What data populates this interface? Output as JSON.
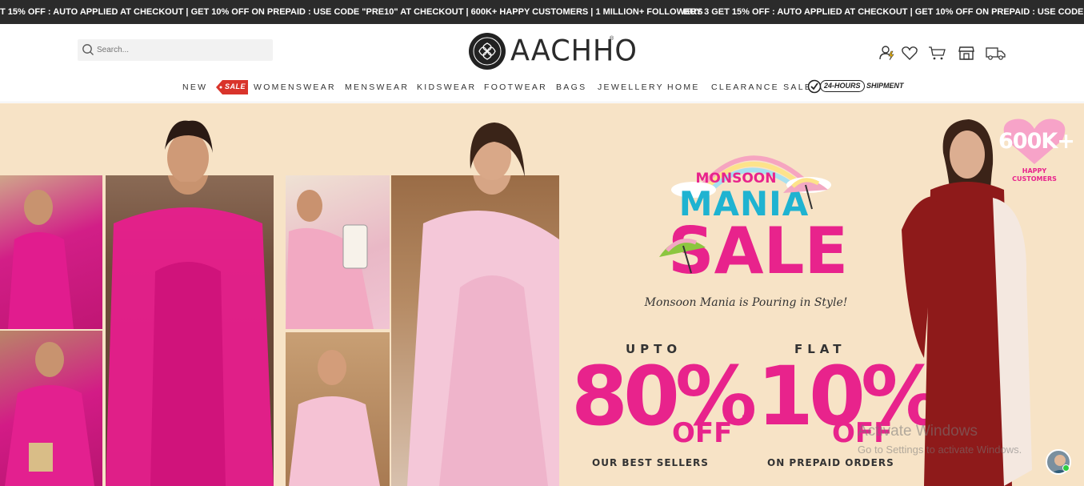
{
  "ticker": {
    "text_a": "T 15% OFF : AUTO APPLIED AT CHECKOUT | GET 10% OFF ON PREPAID : USE CODE \"PRE10\" AT CHECKOUT | 600K+ HAPPY CUSTOMERS | 1 MILLION+ FOLLOWERS",
    "text_b": "BUY 3 GET 15% OFF : AUTO APPLIED AT CHECKOUT | GET 10% OFF ON PREPAID : USE CODE \"PRE"
  },
  "search": {
    "placeholder": "Search..."
  },
  "logo": {
    "text": "AACHHO",
    "reg": "®"
  },
  "header_icons": [
    "account-icon",
    "wishlist-heart-icon",
    "cart-icon",
    "store-icon",
    "delivery-truck-icon"
  ],
  "nav": {
    "new": "NEW",
    "sale_tag": "SALE",
    "womenswear": "WOMENSWEAR",
    "menswear": "MENSWEAR",
    "kidswear": "KIDSWEAR",
    "footwear": "FOOTWEAR",
    "bags": "BAGS",
    "jewellery": "JEWELLERY",
    "home": "HOME",
    "clearance": "CLEARANCE SALE",
    "hours_pill": "24-HOURS",
    "shipment": "SHIPMENT"
  },
  "banner": {
    "badge_count": "600K+",
    "badge_label_1": "HAPPY",
    "badge_label_2": "CUSTOMERS",
    "monsoon": "MONSOON",
    "mania": "MANIA",
    "sale": "SALE",
    "tagline": "Monsoon Mania is Pouring in Style!",
    "upto": "UPTO",
    "pct_left": "80%",
    "off_left": "OFF",
    "plus": "+",
    "flat": "FLAT",
    "pct_right": "10%",
    "off_right": "OFF",
    "sub_left": "OUR BEST SELLERS",
    "sub_right": "ON PREPAID ORDERS"
  },
  "os_watermark": {
    "line1": "Activate Windows",
    "line2": "Go to Settings to activate Windows."
  },
  "colors": {
    "ticker_bg": "#2b2b2b",
    "banner_bg": "#f7e3c6",
    "pink": "#e8238c",
    "cyan": "#1fb3d1",
    "maroon": "#8e1a1a"
  }
}
